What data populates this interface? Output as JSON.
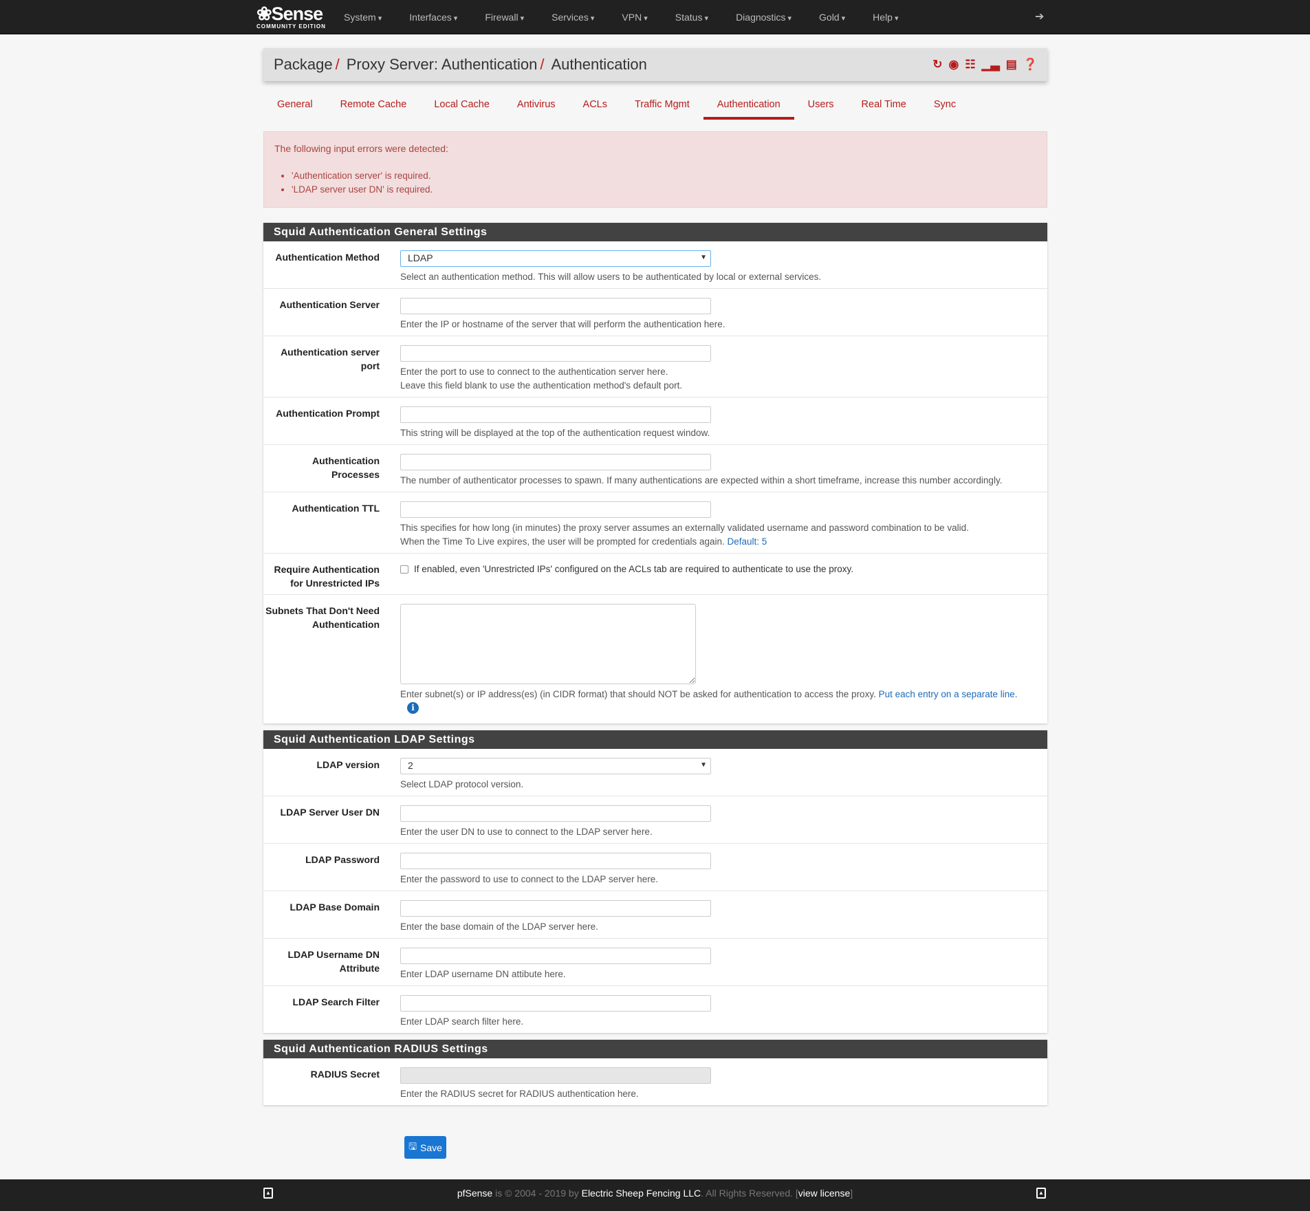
{
  "navbar": {
    "logo": {
      "text": "Sense",
      "tag": "COMMUNITY EDITION"
    },
    "menu": [
      "System",
      "Interfaces",
      "Firewall",
      "Services",
      "VPN",
      "Status",
      "Diagnostics",
      "Gold",
      "Help"
    ],
    "logout_icon": "sign-out-icon"
  },
  "breadcrumb": {
    "items": [
      "Package",
      "Proxy Server: Authentication",
      "Authentication"
    ],
    "separator": "/",
    "icons": [
      "refresh-icon",
      "stop-circle-icon",
      "sliders-icon",
      "bar-chart-icon",
      "list-table-icon",
      "question-circle-icon"
    ]
  },
  "tabs": [
    {
      "label": "General"
    },
    {
      "label": "Remote Cache"
    },
    {
      "label": "Local Cache"
    },
    {
      "label": "Antivirus"
    },
    {
      "label": "ACLs"
    },
    {
      "label": "Traffic Mgmt"
    },
    {
      "label": "Authentication",
      "active": true
    },
    {
      "label": "Users"
    },
    {
      "label": "Real Time"
    },
    {
      "label": "Sync"
    }
  ],
  "alert": {
    "title": "The following input errors were detected:",
    "errors": [
      "'Authentication server' is required.",
      "'LDAP server user DN' is required."
    ]
  },
  "general": {
    "title": "Squid Authentication General Settings",
    "method": {
      "label": "Authentication Method",
      "value": "LDAP",
      "help": "Select an authentication method. This will allow users to be authenticated by local or external services."
    },
    "server": {
      "label": "Authentication Server",
      "help": "Enter the IP or hostname of the server that will perform the authentication here."
    },
    "port": {
      "label": "Authentication server port",
      "help1": "Enter the port to use to connect to the authentication server here.",
      "help2": "Leave this field blank to use the authentication method's default port."
    },
    "prompt": {
      "label": "Authentication Prompt",
      "help": "This string will be displayed at the top of the authentication request window."
    },
    "processes": {
      "label": "Authentication Processes",
      "help": "The number of authenticator processes to spawn. If many authentications are expected within a short timeframe, increase this number accordingly."
    },
    "ttl": {
      "label": "Authentication TTL",
      "help1": "This specifies for how long (in minutes) the proxy server assumes an externally validated username and password combination to be valid.",
      "help2": "When the Time To Live expires, the user will be prompted for credentials again.",
      "default": "Default: 5"
    },
    "unrestricted": {
      "label": "Require Authentication for Unrestricted IPs",
      "help": "If enabled, even 'Unrestricted IPs' configured on the ACLs tab are required to authenticate to use the proxy."
    },
    "subnets": {
      "label": "Subnets That Don't Need Authentication",
      "help": "Enter subnet(s) or IP address(es) (in CIDR format) that should NOT be asked for authentication to access the proxy.",
      "link": "Put each entry on a separate line."
    }
  },
  "ldap": {
    "title": "Squid Authentication LDAP Settings",
    "version": {
      "label": "LDAP version",
      "value": "2",
      "help": "Select LDAP protocol version."
    },
    "userdn": {
      "label": "LDAP Server User DN",
      "help": "Enter the user DN to use to connect to the LDAP server here."
    },
    "password": {
      "label": "LDAP Password",
      "help": "Enter the password to use to connect to the LDAP server here."
    },
    "basedomain": {
      "label": "LDAP Base Domain",
      "help": "Enter the base domain of the LDAP server here."
    },
    "usernamedn": {
      "label": "LDAP Username DN Attribute",
      "help": "Enter LDAP username DN attibute here."
    },
    "filter": {
      "label": "LDAP Search Filter",
      "help": "Enter LDAP search filter here."
    }
  },
  "radius": {
    "title": "Squid Authentication RADIUS Settings",
    "secret": {
      "label": "RADIUS Secret",
      "help": "Enter the RADIUS secret for RADIUS authentication here."
    }
  },
  "save_label": "Save",
  "footer": {
    "brand": "pfSense",
    "text1": " is © 2004 - 2019 by ",
    "company": "Electric Sheep Fencing LLC",
    "text2": ". All Rights Reserved. [",
    "license": "view license",
    "text3": "]"
  },
  "colors": {
    "accent": "#b71c1c",
    "navbar": "#212121",
    "save": "#1976d2",
    "panel_header": "#424242"
  }
}
